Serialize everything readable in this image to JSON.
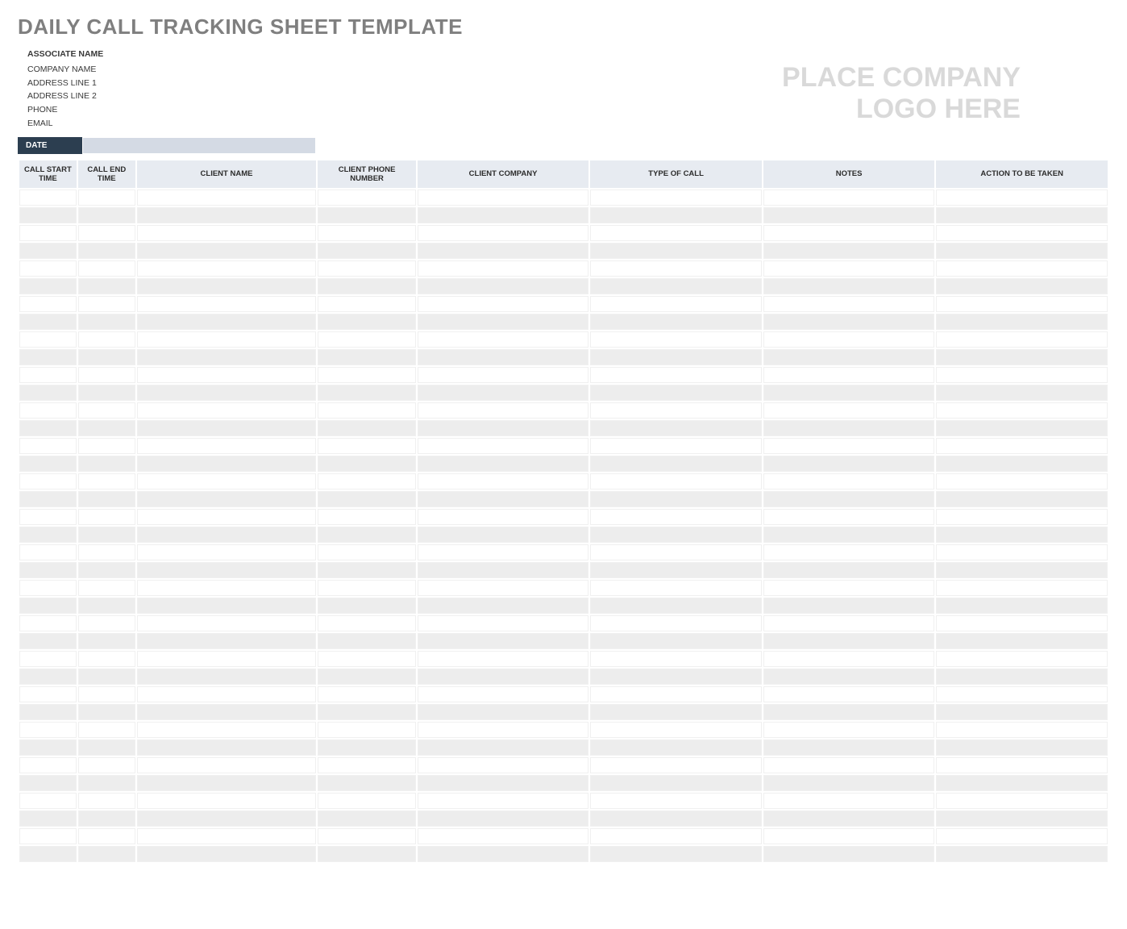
{
  "title": "DAILY CALL TRACKING SHEET TEMPLATE",
  "associate": {
    "name_label": "ASSOCIATE NAME",
    "company": "COMPANY NAME",
    "address1": "ADDRESS LINE 1",
    "address2": "ADDRESS LINE 2",
    "phone": "PHONE",
    "email": "EMAIL"
  },
  "logo_placeholder_line1": "PLACE COMPANY",
  "logo_placeholder_line2": "LOGO HERE",
  "date_label": "DATE",
  "date_value": "",
  "columns": {
    "call_start": "CALL START TIME",
    "call_end": "CALL END TIME",
    "client_name": "CLIENT NAME",
    "client_phone": "CLIENT PHONE NUMBER",
    "client_company": "CLIENT COMPANY",
    "type_of_call": "TYPE OF CALL",
    "notes": "NOTES",
    "action": "ACTION TO BE TAKEN"
  },
  "row_count": 38
}
